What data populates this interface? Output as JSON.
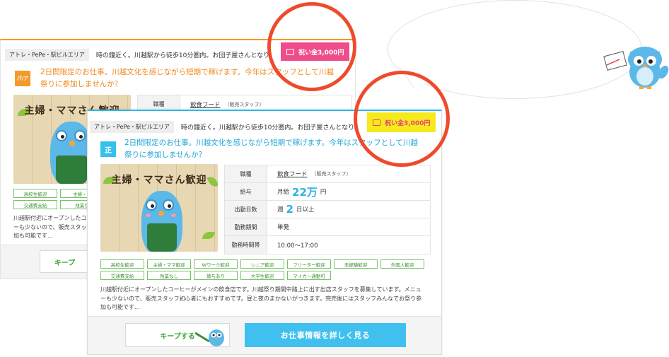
{
  "back_card": {
    "area_tag": "アトレ・PePe・駅ビルエリア",
    "area_desc": "時の鐘近く。川越駅から徒歩10分圏内。お団子屋さんとなり。",
    "bonus_label": "祝い金3,000円",
    "employment_badge": "パ/ア",
    "title_line1": "2日間限定のお仕事。川越文化を感じながら短期で稼げます。今年はスタッフとして川越",
    "title_line2": "祭りに参加しませんか？",
    "illus_caption": "主婦・ママさん歓迎",
    "info": [
      {
        "key": "職種",
        "value": "飲食フード",
        "note": "（販売スタッフ）"
      }
    ],
    "tags": [
      "高校生歓迎",
      "主婦・マ",
      "交通費支給",
      "残業な"
    ],
    "desc_lines": [
      "川越駅付近にオープンしたコ",
      "ーも少ないので、販売スタッ",
      "加も可能です..."
    ],
    "keep_label": "キープ"
  },
  "front_card": {
    "area_tag": "アトレ・PePe・駅ビルエリア",
    "area_desc": "時の鐘近く。川越駅から徒歩10分圏内。お団子屋さんとなり。",
    "bonus_label": "祝い金3,000円",
    "employment_badge": "正",
    "title_line1": "2日間限定のお仕事。川越文化を感じながら短期で稼げます。今年はスタッフとして川越",
    "title_line2": "祭りに参加しませんか？",
    "illus_caption": "主婦・ママさん歓迎",
    "info": {
      "job_key": "職種",
      "job_value": "飲食フード",
      "job_note": "（販売スタッフ）",
      "salary_key": "給与",
      "salary_prefix": "月給",
      "salary_amount": "22万",
      "salary_unit": "円",
      "days_key": "出勤日数",
      "days_prefix": "週",
      "days_amount": "2",
      "days_unit": "日以上",
      "period_key": "勤務期間",
      "period_value": "単発",
      "hours_key": "勤務時間帯",
      "hours_value": "10:00〜17:00"
    },
    "tags": [
      "高校生歓迎",
      "主婦・ママ歓迎",
      "Wワーク歓迎",
      "シニア歓迎",
      "フリーター歓迎",
      "未経験歓迎",
      "外国人歓迎",
      "交通費支給",
      "残業なし",
      "賞与あり",
      "大学生歓迎",
      "マイカー通勤可"
    ],
    "desc_lines": [
      "川越駅付近にオープンしたコーヒーがメインの飲食店です。川越祭り期間中路上に出す出店スタッフを募集しています。メニュ",
      "ーも少ないので、販売スタッフ初心者にもおすすめです。昼と夜のまかないがつきます。完売後にはスタッフみんなでお祭り参",
      "加も可能です..."
    ],
    "keep_label": "キープする",
    "detail_label": "お仕事情報を詳しく見る"
  },
  "colors": {
    "orange": "#f39a2a",
    "blue": "#35c0ee",
    "red_circle": "#ef4a2c",
    "pink": "#ee4d8a",
    "yellow": "#f7ea1c",
    "green": "#3ea737"
  }
}
